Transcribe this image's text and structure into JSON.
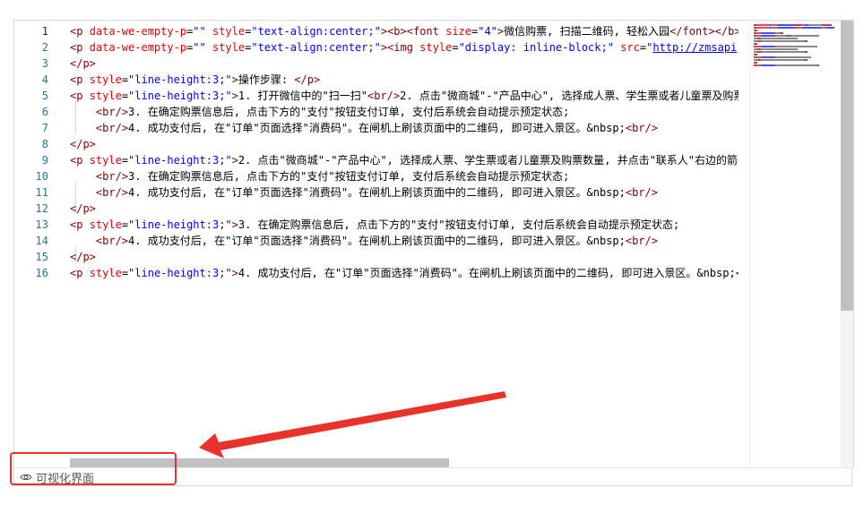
{
  "editor": {
    "line_numbers": [
      "1",
      "2",
      "3",
      "4",
      "5",
      "6",
      "7",
      "8",
      "9",
      "10",
      "11",
      "12",
      "13",
      "14",
      "15",
      "16"
    ],
    "lines": [
      [
        {
          "c": "t-tag",
          "t": "<p "
        },
        {
          "c": "t-attr",
          "t": "data-we-empty-p"
        },
        {
          "c": "t-txt",
          "t": "="
        },
        {
          "c": "t-val",
          "t": "\"\""
        },
        {
          "c": "t-txt",
          "t": " "
        },
        {
          "c": "t-attr",
          "t": "style"
        },
        {
          "c": "t-txt",
          "t": "="
        },
        {
          "c": "t-val",
          "t": "\"text-align:center;\""
        },
        {
          "c": "t-tag",
          "t": "><b><font "
        },
        {
          "c": "t-attr",
          "t": "size"
        },
        {
          "c": "t-txt",
          "t": "="
        },
        {
          "c": "t-val",
          "t": "\"4\""
        },
        {
          "c": "t-tag",
          "t": ">"
        },
        {
          "c": "t-txt",
          "t": "微信购票, 扫描二维码, 轻松入园"
        },
        {
          "c": "t-tag",
          "t": "</font></b><"
        }
      ],
      [
        {
          "c": "t-tag",
          "t": "<p "
        },
        {
          "c": "t-attr",
          "t": "data-we-empty-p"
        },
        {
          "c": "t-txt",
          "t": "="
        },
        {
          "c": "t-val",
          "t": "\"\""
        },
        {
          "c": "t-txt",
          "t": " "
        },
        {
          "c": "t-attr",
          "t": "style"
        },
        {
          "c": "t-txt",
          "t": "="
        },
        {
          "c": "t-val",
          "t": "\"text-align:center;\""
        },
        {
          "c": "t-tag",
          "t": "><img "
        },
        {
          "c": "t-attr",
          "t": "style"
        },
        {
          "c": "t-txt",
          "t": "="
        },
        {
          "c": "t-val",
          "t": "\"display: inline-block;\""
        },
        {
          "c": "t-txt",
          "t": " "
        },
        {
          "c": "t-attr",
          "t": "src"
        },
        {
          "c": "t-txt",
          "t": "="
        },
        {
          "c": "t-val",
          "t": "\""
        },
        {
          "c": "t-link",
          "t": "http://zmsapi"
        }
      ],
      [
        {
          "c": "t-tag",
          "t": "</p>"
        }
      ],
      [
        {
          "c": "t-tag",
          "t": "<p "
        },
        {
          "c": "t-attr",
          "t": "style"
        },
        {
          "c": "t-txt",
          "t": "="
        },
        {
          "c": "t-val",
          "t": "\"line-height:3;\""
        },
        {
          "c": "t-tag",
          "t": ">"
        },
        {
          "c": "t-txt",
          "t": "操作步骤: "
        },
        {
          "c": "t-tag",
          "t": "</p>"
        }
      ],
      [
        {
          "c": "t-tag",
          "t": "<p "
        },
        {
          "c": "t-attr",
          "t": "style"
        },
        {
          "c": "t-txt",
          "t": "="
        },
        {
          "c": "t-val",
          "t": "\"line-height:3;\""
        },
        {
          "c": "t-tag",
          "t": ">"
        },
        {
          "c": "t-txt",
          "t": "1. 打开微信中的\"扫一扫\""
        },
        {
          "c": "t-tag",
          "t": "<br/>"
        },
        {
          "c": "t-txt",
          "t": "2. 点击\"微商城\"-\"产品中心\", 选择成人票、学生票或者儿童票及购票"
        }
      ],
      [
        {
          "c": "t-txt",
          "t": "    "
        },
        {
          "c": "t-tag",
          "t": "<br/>"
        },
        {
          "c": "t-txt",
          "t": "3. 在确定购票信息后, 点击下方的\"支付\"按钮支付订单, 支付后系统会自动提示预定状态;"
        }
      ],
      [
        {
          "c": "t-txt",
          "t": "    "
        },
        {
          "c": "t-tag",
          "t": "<br/>"
        },
        {
          "c": "t-txt",
          "t": "4. 成功支付后, 在\"订单\"页面选择\"消费码\"。在闸机上刷该页面中的二维码, 即可进入景区。&nbsp;"
        },
        {
          "c": "t-tag",
          "t": "<br/>"
        }
      ],
      [
        {
          "c": "t-tag",
          "t": "</p>"
        }
      ],
      [
        {
          "c": "t-tag",
          "t": "<p "
        },
        {
          "c": "t-attr",
          "t": "style"
        },
        {
          "c": "t-txt",
          "t": "="
        },
        {
          "c": "t-val",
          "t": "\"line-height:3;\""
        },
        {
          "c": "t-tag",
          "t": ">"
        },
        {
          "c": "t-txt",
          "t": "2. 点击\"微商城\"-\"产品中心\", 选择成人票、学生票或者儿童票及购票数量, 并点击\"联系人\"右边的箭头"
        }
      ],
      [
        {
          "c": "t-txt",
          "t": "    "
        },
        {
          "c": "t-tag",
          "t": "<br/>"
        },
        {
          "c": "t-txt",
          "t": "3. 在确定购票信息后, 点击下方的\"支付\"按钮支付订单, 支付后系统会自动提示预定状态;"
        }
      ],
      [
        {
          "c": "t-txt",
          "t": "    "
        },
        {
          "c": "t-tag",
          "t": "<br/>"
        },
        {
          "c": "t-txt",
          "t": "4. 成功支付后, 在\"订单\"页面选择\"消费码\"。在闸机上刷该页面中的二维码, 即可进入景区。&nbsp;"
        },
        {
          "c": "t-tag",
          "t": "<br/>"
        }
      ],
      [
        {
          "c": "t-tag",
          "t": "</p>"
        }
      ],
      [
        {
          "c": "t-tag",
          "t": "<p "
        },
        {
          "c": "t-attr",
          "t": "style"
        },
        {
          "c": "t-txt",
          "t": "="
        },
        {
          "c": "t-val",
          "t": "\"line-height:3;\""
        },
        {
          "c": "t-tag",
          "t": ">"
        },
        {
          "c": "t-txt",
          "t": "3. 在确定购票信息后, 点击下方的\"支付\"按钮支付订单, 支付后系统会自动提示预定状态;"
        }
      ],
      [
        {
          "c": "t-txt",
          "t": "    "
        },
        {
          "c": "t-tag",
          "t": "<br/>"
        },
        {
          "c": "t-txt",
          "t": "4. 成功支付后, 在\"订单\"页面选择\"消费码\"。在闸机上刷该页面中的二维码, 即可进入景区。&nbsp;"
        },
        {
          "c": "t-tag",
          "t": "<br/>"
        }
      ],
      [
        {
          "c": "t-tag",
          "t": "</p>"
        }
      ],
      [
        {
          "c": "t-tag",
          "t": "<p "
        },
        {
          "c": "t-attr",
          "t": "style"
        },
        {
          "c": "t-txt",
          "t": "="
        },
        {
          "c": "t-val",
          "t": "\"line-height:3;\""
        },
        {
          "c": "t-tag",
          "t": ">"
        },
        {
          "c": "t-txt",
          "t": "4. 成功支付后, 在\"订单\"页面选择\"消费码\"。在闸机上刷该页面中的二维码, 即可进入景区。&nbsp;"
        },
        {
          "c": "t-tag",
          "t": "<b"
        }
      ]
    ]
  },
  "statusbar": {
    "visual_toggle_label": "可视化界面",
    "icon": "eye-icon"
  },
  "colors": {
    "tag": "#800000",
    "attr": "#e50000",
    "value": "#0000ff",
    "line_number": "#237893",
    "annotation": "#e8322a"
  }
}
